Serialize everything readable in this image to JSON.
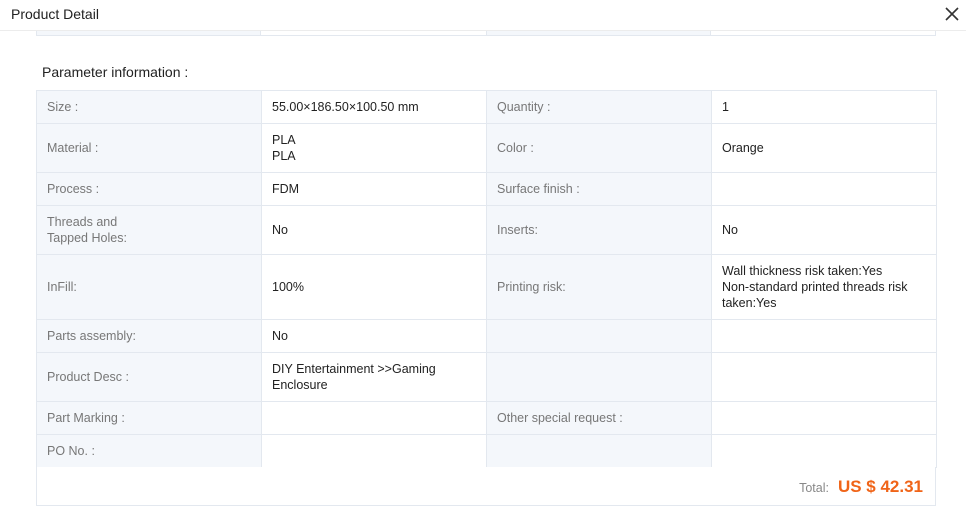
{
  "header": {
    "title": "Product Detail"
  },
  "section": {
    "title": "Parameter information :"
  },
  "rows": [
    {
      "l1": "Size :",
      "v1": "55.00×186.50×100.50 mm",
      "l2": "Quantity :",
      "v2": "1"
    },
    {
      "l1": "Material :",
      "v1": "PLA\nPLA",
      "l2": "Color :",
      "v2": "Orange"
    },
    {
      "l1": "Process :",
      "v1": "FDM",
      "l2": "Surface finish :",
      "v2": ""
    },
    {
      "l1": "Threads and\nTapped Holes:",
      "v1": "No",
      "l2": "Inserts:",
      "v2": "No"
    },
    {
      "l1": "InFill:",
      "v1": "100%",
      "l2": "Printing risk:",
      "v2": "Wall thickness risk taken:Yes\nNon-standard printed threads risk taken:Yes"
    },
    {
      "l1": "Parts assembly:",
      "v1": "No",
      "l2": "",
      "v2": ""
    },
    {
      "l1": "Product Desc :",
      "v1": "DIY Entertainment >>Gaming Enclosure",
      "l2": "",
      "v2": ""
    },
    {
      "l1": "Part Marking :",
      "v1": "",
      "l2": "Other special request :",
      "v2": ""
    },
    {
      "l1": "PO No. :",
      "v1": "",
      "l2": "",
      "v2": ""
    }
  ],
  "total": {
    "label": "Total:",
    "value": "US $ 42.31"
  },
  "colors": {
    "accent": "#f06418",
    "label_bg": "#f4f7fb",
    "border": "#e3e8ef"
  }
}
